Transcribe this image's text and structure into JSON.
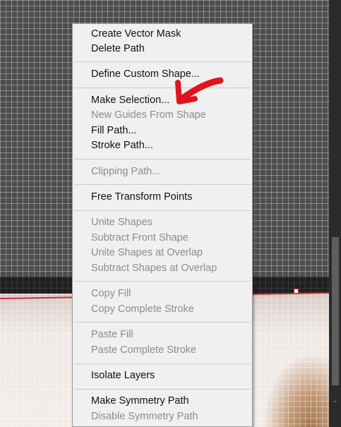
{
  "context_menu": {
    "groups": [
      {
        "items": [
          {
            "label": "Create Vector Mask",
            "enabled": true
          },
          {
            "label": "Delete Path",
            "enabled": true
          }
        ]
      },
      {
        "items": [
          {
            "label": "Define Custom Shape...",
            "enabled": true
          }
        ]
      },
      {
        "items": [
          {
            "label": "Make Selection...",
            "enabled": true
          },
          {
            "label": "New Guides From Shape",
            "enabled": false
          },
          {
            "label": "Fill Path...",
            "enabled": true
          },
          {
            "label": "Stroke Path...",
            "enabled": true
          }
        ]
      },
      {
        "items": [
          {
            "label": "Clipping Path...",
            "enabled": false
          }
        ]
      },
      {
        "items": [
          {
            "label": "Free Transform Points",
            "enabled": true
          }
        ]
      },
      {
        "items": [
          {
            "label": "Unite Shapes",
            "enabled": false
          },
          {
            "label": "Subtract Front Shape",
            "enabled": false
          },
          {
            "label": "Unite Shapes at Overlap",
            "enabled": false
          },
          {
            "label": "Subtract Shapes at Overlap",
            "enabled": false
          }
        ]
      },
      {
        "items": [
          {
            "label": "Copy Fill",
            "enabled": false
          },
          {
            "label": "Copy Complete Stroke",
            "enabled": false
          }
        ]
      },
      {
        "items": [
          {
            "label": "Paste Fill",
            "enabled": false
          },
          {
            "label": "Paste Complete Stroke",
            "enabled": false
          }
        ]
      },
      {
        "items": [
          {
            "label": "Isolate Layers",
            "enabled": true
          }
        ]
      },
      {
        "items": [
          {
            "label": "Make Symmetry Path",
            "enabled": true
          },
          {
            "label": "Disable Symmetry Path",
            "enabled": false
          }
        ]
      }
    ]
  },
  "colors": {
    "menu_background": "#f0f0f0",
    "menu_text": "#111111",
    "menu_text_disabled": "#8c8c8c",
    "annotation_arrow": "#e0141e",
    "path_stroke": "#c8303a"
  },
  "icons": {
    "scroll_down": "chevron-down-icon",
    "scroll_right": "chevron-right-icon",
    "annotation": "red-arrow-icon"
  },
  "scroll_glyphs": {
    "down": "⌄",
    "right": "›"
  }
}
